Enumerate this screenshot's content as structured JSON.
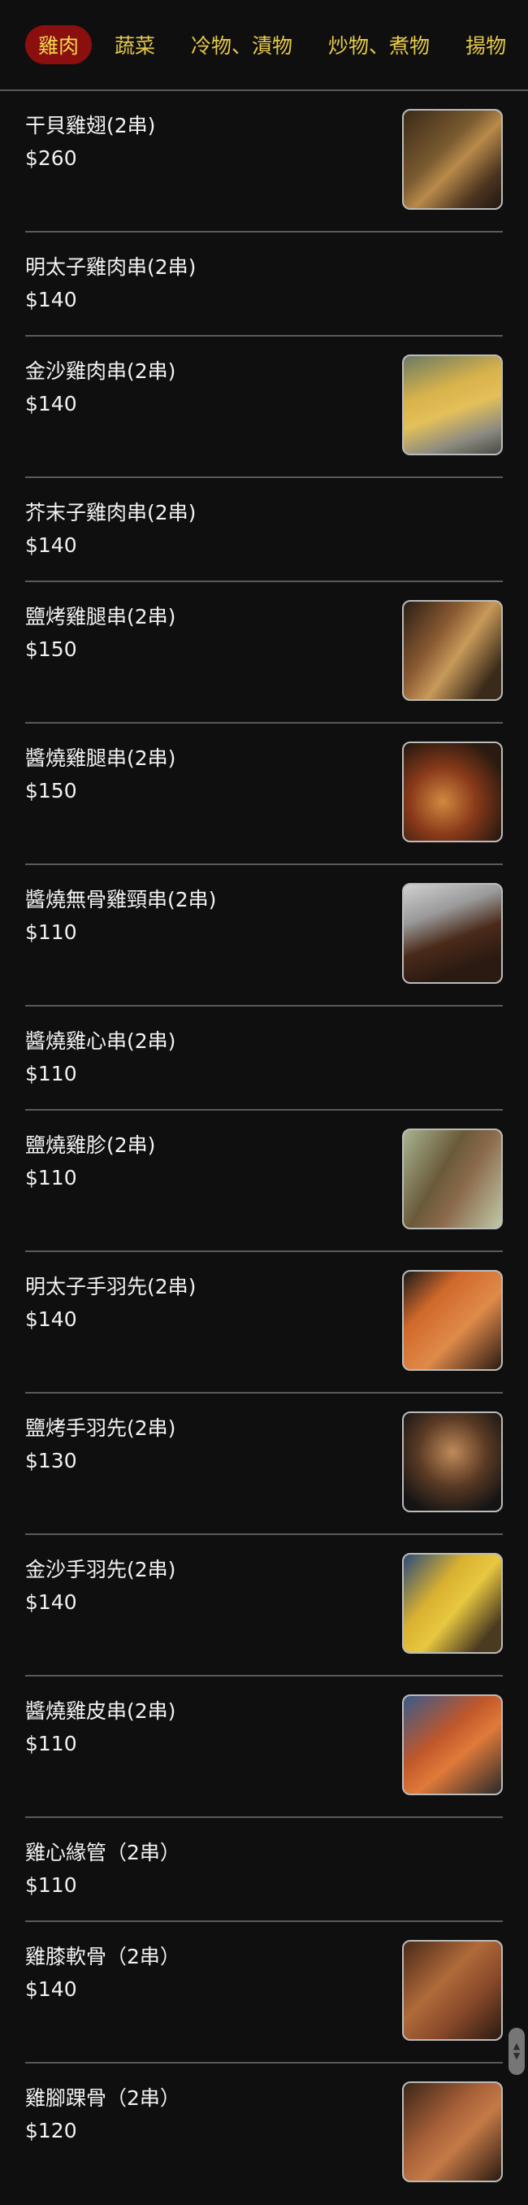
{
  "tabs": [
    "雞肉",
    "蔬菜",
    "冷物、漬物",
    "炒物、煮物",
    "揚物"
  ],
  "items": [
    {
      "name": "干貝雞翅(2串)",
      "price": "$260",
      "image": "chicken-wing-skewer"
    },
    {
      "name": "明太子雞肉串(2串)",
      "price": "$140",
      "image": ""
    },
    {
      "name": "金沙雞肉串(2串)",
      "price": "$140",
      "image": "golden-chicken-skewer"
    },
    {
      "name": "芥末子雞肉串(2串)",
      "price": "$140",
      "image": ""
    },
    {
      "name": "鹽烤雞腿串(2串)",
      "price": "$150",
      "image": "salt-grilled-thigh"
    },
    {
      "name": "醬燒雞腿串(2串)",
      "price": "$150",
      "image": "sauce-grilled-thigh"
    },
    {
      "name": "醬燒無骨雞頸串(2串)",
      "price": "$110",
      "image": "neck-skewer"
    },
    {
      "name": "醬燒雞心串(2串)",
      "price": "$110",
      "image": ""
    },
    {
      "name": "鹽燒雞胗(2串)",
      "price": "$110",
      "image": "gizzard-skewer"
    },
    {
      "name": "明太子手羽先(2串)",
      "price": "$140",
      "image": "mentaiko-wing"
    },
    {
      "name": "鹽烤手羽先(2串)",
      "price": "$130",
      "image": "salt-wing"
    },
    {
      "name": "金沙手羽先(2串)",
      "price": "$140",
      "image": "golden-wing"
    },
    {
      "name": "醬燒雞皮串(2串)",
      "price": "$110",
      "image": "chicken-skin-skewer"
    },
    {
      "name": "雞心緣管（2串）",
      "price": "$110",
      "image": ""
    },
    {
      "name": "雞膝軟骨（2串）",
      "price": "$140",
      "image": "knee-cartilage"
    },
    {
      "name": "雞腳踝骨（2串）",
      "price": "$120",
      "image": "ankle-bone"
    }
  ]
}
